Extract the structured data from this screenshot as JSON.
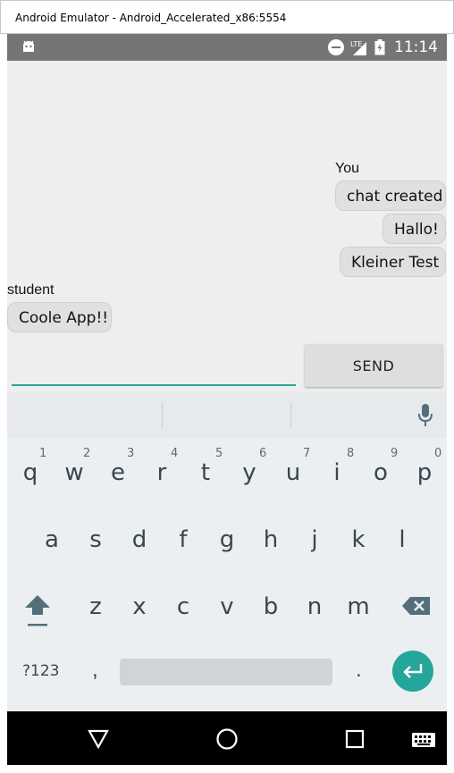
{
  "window": {
    "title": "Android Emulator - Android_Accelerated_x86:5554"
  },
  "status_bar": {
    "time": "11:14",
    "network": "LTE"
  },
  "chat": {
    "messages": [
      {
        "sender": "You",
        "texts": [
          "chat created",
          "Hallo!",
          "Kleiner Test"
        ]
      },
      {
        "sender": "student",
        "texts": [
          "Coole App!!"
        ]
      }
    ]
  },
  "composer": {
    "input_value": "",
    "send_label": "SEND"
  },
  "keyboard": {
    "row1": [
      "q",
      "w",
      "e",
      "r",
      "t",
      "y",
      "u",
      "i",
      "o",
      "p"
    ],
    "row1_hints": [
      "1",
      "2",
      "3",
      "4",
      "5",
      "6",
      "7",
      "8",
      "9",
      "0"
    ],
    "row2": [
      "a",
      "s",
      "d",
      "f",
      "g",
      "h",
      "j",
      "k",
      "l"
    ],
    "row3": [
      "z",
      "x",
      "c",
      "v",
      "b",
      "n",
      "m"
    ],
    "symbols_label": "?123",
    "comma": ",",
    "period": "."
  },
  "colors": {
    "accent": "#26a69a",
    "status_bar": "#757575",
    "bubble": "#e0e0e0",
    "key_text": "#37474f"
  }
}
